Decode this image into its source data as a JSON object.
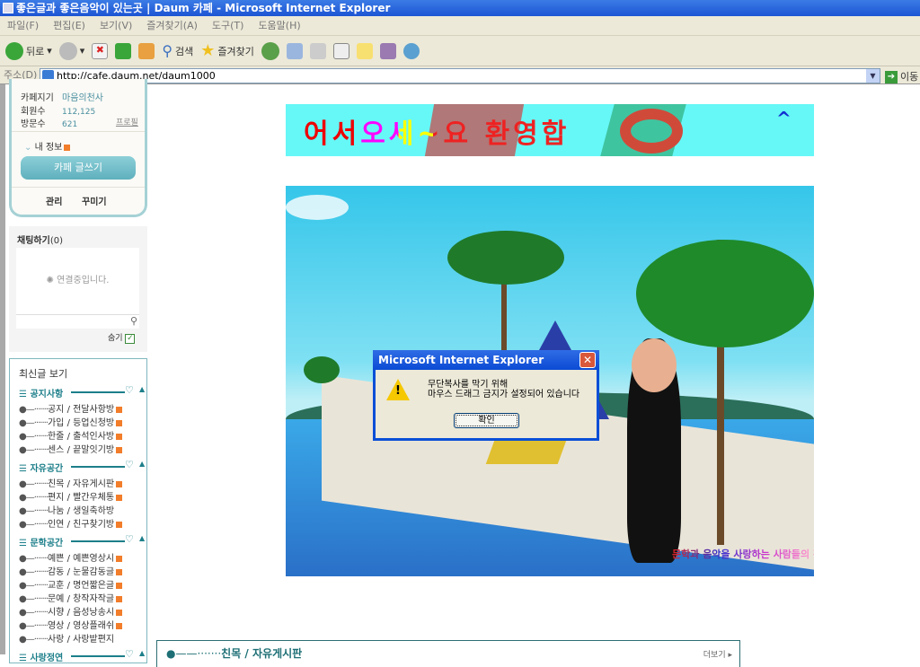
{
  "window": {
    "title": "좋은글과 좋은음악이 있는곳 | Daum 카페 - Microsoft Internet Explorer"
  },
  "menu": [
    "파일(F)",
    "편집(E)",
    "보기(V)",
    "즐겨찾기(A)",
    "도구(T)",
    "도움말(H)"
  ],
  "toolbar": {
    "back": "뒤로",
    "search": "검색",
    "favorites": "즐겨찾기"
  },
  "address": {
    "label": "주소(D)",
    "url": "http://cafe.daum.net/daum1000",
    "go": "이동"
  },
  "cafe_info": {
    "owner_label": "카페지기",
    "owner": "마음의천사",
    "members_label": "회원수",
    "members": "112,125",
    "visits_label": "방문수",
    "visits": "621",
    "profile": "프로필",
    "my_info": "내 정보",
    "write": "카페 글쓰기",
    "manage": "관리",
    "decorate": "꾸미기"
  },
  "chat": {
    "title": "채팅하기",
    "count": "(0)",
    "status": "연결중입니다.",
    "hide": "숨기"
  },
  "recent": {
    "title": "최신글 보기",
    "categories": [
      {
        "name": "공지사항",
        "items": [
          {
            "label": "공지 / 전달사항방",
            "new": true
          },
          {
            "label": "가입 / 등업신청방",
            "new": true
          },
          {
            "label": "한줄 / 출석인사방",
            "new": true
          },
          {
            "label": "센스 / 끝말잇기방",
            "new": true
          }
        ]
      },
      {
        "name": "자유공간",
        "items": [
          {
            "label": "친목 / 자유게시판",
            "new": true
          },
          {
            "label": "편지 / 빨간우체통",
            "new": true
          },
          {
            "label": "나눔 / 생일축하방",
            "new": false
          },
          {
            "label": "인연 / 친구찾기방",
            "new": true
          }
        ]
      },
      {
        "name": "문학공간",
        "items": [
          {
            "label": "예쁜 / 예쁜영상시",
            "new": true
          },
          {
            "label": "감동 / 눈물감동글",
            "new": true
          },
          {
            "label": "교훈 / 명언짧은글",
            "new": true
          },
          {
            "label": "문예 / 창작자작글",
            "new": true
          },
          {
            "label": "시향 / 음성낭송시",
            "new": true
          },
          {
            "label": "영상 / 영상플래쉬",
            "new": true
          },
          {
            "label": "사랑 / 사랑밭편지",
            "new": false
          }
        ]
      },
      {
        "name": "사랑정연",
        "items": []
      }
    ]
  },
  "banner": {
    "text": "어서오세~요 환영합",
    "caret": "^"
  },
  "scene": {
    "watermark": "문학과 음악을 사랑하는 사람들의 편안한쉼터"
  },
  "dialog": {
    "title": "Microsoft Internet Explorer",
    "line1": "무단복사를 막기 위해",
    "line2": "마우스 드래그 금지가 설정되어 있습니다",
    "ok": "확인"
  },
  "board": {
    "title": "친목 / 자유게시판",
    "more": "더보기 ▸"
  }
}
